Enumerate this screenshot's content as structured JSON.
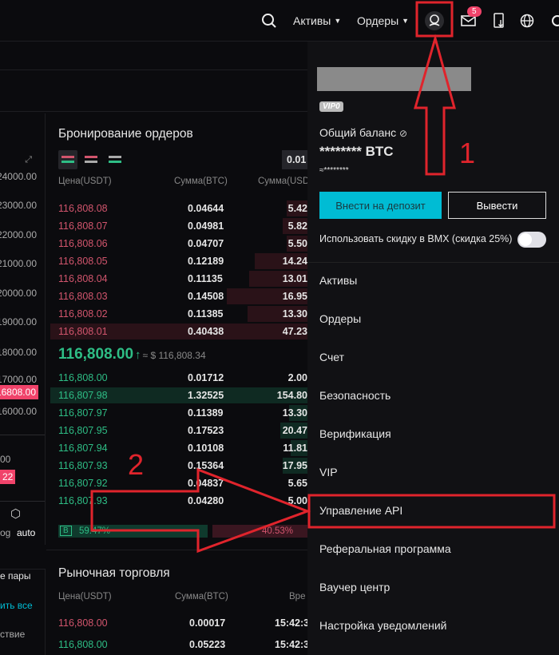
{
  "header": {
    "assets": "Активы",
    "orders": "Ордеры",
    "mail_badge": "5"
  },
  "chart": {
    "y_labels": [
      "24000.00",
      "23000.00",
      "22000.00",
      "21000.00",
      "20000.00",
      "19000.00",
      "18000.00",
      "17000.00",
      "16000.00"
    ],
    "current_price_tag": "16808.00",
    "partial_values": [
      "00",
      "22"
    ],
    "log_label": "og",
    "auto_label": "auto"
  },
  "orderbook": {
    "title": "Бронирование ордеров",
    "precision": "0.01",
    "col_price": "Цена(USDT)",
    "col_amount": "Сумма(BTC)",
    "col_total": "Сумма(USD",
    "asks": [
      {
        "p": "116,808.08",
        "a": "0.04644",
        "t": "5.42",
        "d": 0.12
      },
      {
        "p": "116,808.07",
        "a": "0.04981",
        "t": "5.82",
        "d": 0.14
      },
      {
        "p": "116,808.06",
        "a": "0.04707",
        "t": "5.50",
        "d": 0.12
      },
      {
        "p": "116,808.05",
        "a": "0.12189",
        "t": "14.24",
        "d": 0.3
      },
      {
        "p": "116,808.04",
        "a": "0.11135",
        "t": "13.01",
        "d": 0.33
      },
      {
        "p": "116,808.03",
        "a": "0.14508",
        "t": "16.95",
        "d": 0.46
      },
      {
        "p": "116,808.02",
        "a": "0.11385",
        "t": "13.30",
        "d": 0.34
      },
      {
        "p": "116,808.01",
        "a": "0.40438",
        "t": "47.23",
        "d": 1.0
      }
    ],
    "last_price": "116,808.00",
    "last_price_usd": "≈ $ 116,808.34",
    "bids": [
      {
        "p": "116,808.00",
        "a": "0.01712",
        "t": "2.00",
        "d": 0
      },
      {
        "p": "116,807.98",
        "a": "1.32525",
        "t": "154.80",
        "d": 1.0
      },
      {
        "p": "116,807.97",
        "a": "0.11389",
        "t": "13.30",
        "d": 0.09
      },
      {
        "p": "116,807.95",
        "a": "0.17523",
        "t": "20.47",
        "d": 0.13
      },
      {
        "p": "116,807.94",
        "a": "0.10108",
        "t": "11.81",
        "d": 0.08
      },
      {
        "p": "116,807.93",
        "a": "0.15364",
        "t": "17.95",
        "d": 0.12
      },
      {
        "p": "116,807.92",
        "a": "0.04837",
        "t": "5.65",
        "d": 0
      },
      {
        "p": "116,807.93",
        "a": "0.04280",
        "t": "5.00",
        "d": 0
      }
    ],
    "buy_label": "B",
    "buy_pct": "59.47%",
    "sell_pct": "40.53%",
    "buy_ratio": 59.47
  },
  "left_labels": {
    "pairs": "е пары",
    "clear": "ить все",
    "action": "ствие"
  },
  "market": {
    "title": "Рыночная торговля",
    "col_price": "Цена(USDT)",
    "col_amount": "Сумма(BTC)",
    "col_time": "Вре",
    "rows": [
      {
        "p": "116,808.00",
        "a": "0.00017",
        "t": "15:42:3",
        "side": "sell"
      },
      {
        "p": "116,808.00",
        "a": "0.05223",
        "t": "15:42:3",
        "side": "buy"
      }
    ]
  },
  "account": {
    "vip": "VIP0",
    "balance_label": "Общий баланс",
    "balance": "******** BTC",
    "balance_fiat": "≈********",
    "deposit": "Внести на депозит",
    "withdraw": "Вывести",
    "discount_label": "Использовать скидку в BMX (скидка 25%)",
    "discount_on": false,
    "menu": [
      "Активы",
      "Ордеры",
      "Счет",
      "Безопасность",
      "Верификация",
      "VIP",
      "Управление API",
      "Реферальная программа",
      "Ваучер центр",
      "Настройка уведомлений"
    ]
  },
  "annotations": {
    "step1": "1",
    "step2": "2",
    "color": "#e0242c"
  },
  "colors": {
    "accent": "#00bcd4",
    "ask": "#d2556d",
    "bid": "#2ebd85"
  }
}
